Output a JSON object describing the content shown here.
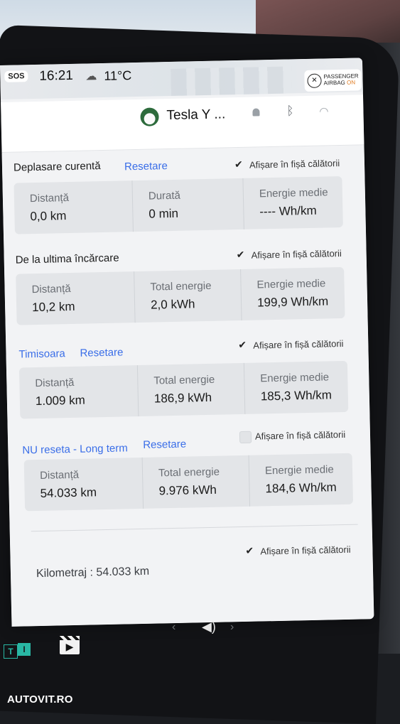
{
  "status": {
    "sos": "SOS",
    "time": "16:21",
    "weather_icon": "partly-cloudy-icon",
    "temperature": "11°C",
    "airbag_line1": "PASSENGER",
    "airbag_line2": "AIRBAG",
    "airbag_state": "ON"
  },
  "profile": {
    "car_name": "Tesla Y ...",
    "icons": [
      "bell-icon",
      "bluetooth-icon",
      "wifi-icon"
    ]
  },
  "sections": [
    {
      "title": "Deplasare curentă",
      "reset_label": "Resetare",
      "checkbox_label": "Afișare în fișă călătorii",
      "checked": true,
      "cells": [
        {
          "label": "Distanță",
          "value": "0,0 km"
        },
        {
          "label": "Durată",
          "value": "0 min"
        },
        {
          "label": "Energie medie",
          "value": "---- Wh/km"
        }
      ]
    },
    {
      "title": "De la ultima încărcare",
      "reset_label": "",
      "checkbox_label": "Afișare în fișă călătorii",
      "checked": true,
      "cells": [
        {
          "label": "Distanță",
          "value": "10,2 km"
        },
        {
          "label": "Total energie",
          "value": "2,0 kWh"
        },
        {
          "label": "Energie medie",
          "value": "199,9 Wh/km"
        }
      ]
    },
    {
      "title": "Timisoara",
      "reset_label": "Resetare",
      "checkbox_label": "Afișare în fișă călătorii",
      "checked": true,
      "cells": [
        {
          "label": "Distanță",
          "value": "1.009 km"
        },
        {
          "label": "Total energie",
          "value": "186,9 kWh"
        },
        {
          "label": "Energie medie",
          "value": "185,3 Wh/km"
        }
      ]
    },
    {
      "title": "NU reseta - Long term",
      "reset_label": "Resetare",
      "checkbox_label": "Afișare în fișă călătorii",
      "checked": false,
      "cells": [
        {
          "label": "Distanță",
          "value": "54.033 km"
        },
        {
          "label": "Total energie",
          "value": "9.976 kWh"
        },
        {
          "label": "Energie medie",
          "value": "184,6 Wh/km"
        }
      ]
    }
  ],
  "odometer": {
    "text": "Kilometraj : 54.033 km",
    "checkbox_label": "Afișare în fișă călătorii",
    "checked": true
  },
  "watermark": "AUTOVIT.RO",
  "colors": {
    "link": "#3a6ee8",
    "airbag_on": "#e07a1f",
    "logo": "#29b7a4"
  }
}
